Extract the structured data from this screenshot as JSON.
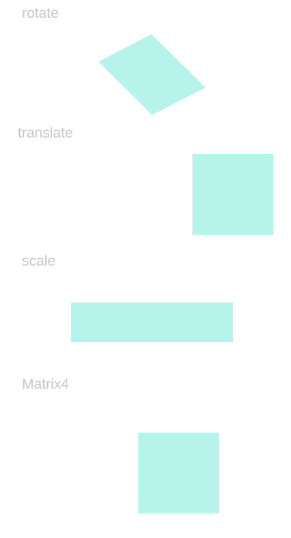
{
  "sections": {
    "rotate": {
      "label": "rotate"
    },
    "translate": {
      "label": "translate"
    },
    "scale": {
      "label": "scale"
    },
    "matrix": {
      "label": "Matrix4"
    }
  },
  "colors": {
    "shape_fill": "#b5f3eb",
    "label_text": "#c8c8c8",
    "background": "#ffffff"
  }
}
